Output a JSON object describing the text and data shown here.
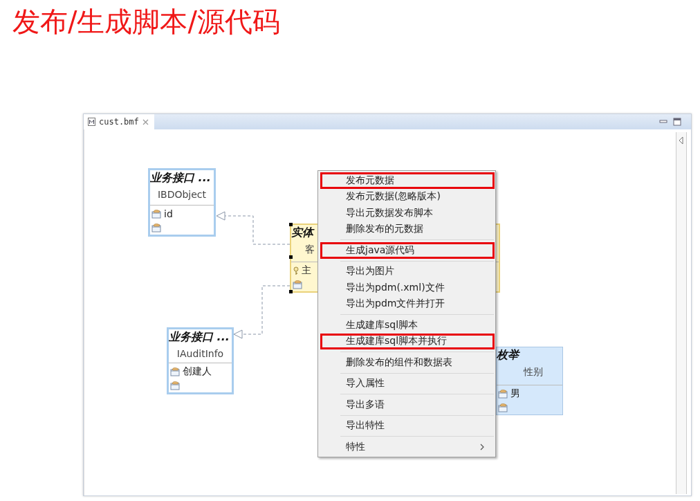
{
  "slide_title": "发布/生成脚本/源代码",
  "editor": {
    "tab": {
      "label": "cust.bmf",
      "selected": true
    },
    "nodes": [
      {
        "kind": "interface",
        "title": "业务接口 ...",
        "name": "IBDObject",
        "selected": false,
        "rows": [
          {
            "kind": "field",
            "label": "id"
          },
          {
            "kind": "field"
          }
        ]
      },
      {
        "kind": "entity",
        "title": "实体",
        "name": "客",
        "selected": true,
        "rows": [
          {
            "kind": "key",
            "label": "主"
          },
          {
            "kind": "field"
          }
        ]
      },
      {
        "kind": "interface",
        "title": "业务接口 ...",
        "name": "IAuditInfo",
        "selected": false,
        "rows": [
          {
            "kind": "field",
            "label": "创建人"
          },
          {
            "kind": "field"
          }
        ]
      },
      {
        "kind": "enum",
        "title": "枚举",
        "name": "性别",
        "selected": false,
        "rows": [
          {
            "kind": "field",
            "label": "男"
          },
          {
            "kind": "field"
          }
        ]
      }
    ],
    "context_menu": {
      "groups": [
        [
          {
            "label": "发布元数据",
            "highlighted": true,
            "submenu": false
          },
          {
            "label": "发布元数据(忽略版本)",
            "highlighted": false,
            "submenu": false
          },
          {
            "label": "导出元数据发布脚本",
            "highlighted": false,
            "submenu": false
          },
          {
            "label": "删除发布的元数据",
            "highlighted": false,
            "submenu": false
          }
        ],
        [
          {
            "label": "生成java源代码",
            "highlighted": true,
            "submenu": false
          }
        ],
        [
          {
            "label": "导出为图片",
            "highlighted": false,
            "submenu": false
          },
          {
            "label": "导出为pdm(.xml)文件",
            "highlighted": false,
            "submenu": false
          },
          {
            "label": "导出为pdm文件并打开",
            "highlighted": false,
            "submenu": false
          }
        ],
        [
          {
            "label": "生成建库sql脚本",
            "highlighted": false,
            "submenu": false
          },
          {
            "label": "生成建库sql脚本并执行",
            "highlighted": true,
            "submenu": false
          }
        ],
        [
          {
            "label": "删除发布的组件和数据表",
            "highlighted": false,
            "submenu": false
          }
        ],
        [
          {
            "label": "导入属性",
            "highlighted": false,
            "submenu": false
          }
        ],
        [
          {
            "label": "导出多语",
            "highlighted": false,
            "submenu": false
          }
        ],
        [
          {
            "label": "导出特性",
            "highlighted": false,
            "submenu": false
          }
        ],
        [
          {
            "label": "特性",
            "highlighted": false,
            "submenu": true
          }
        ]
      ]
    }
  }
}
